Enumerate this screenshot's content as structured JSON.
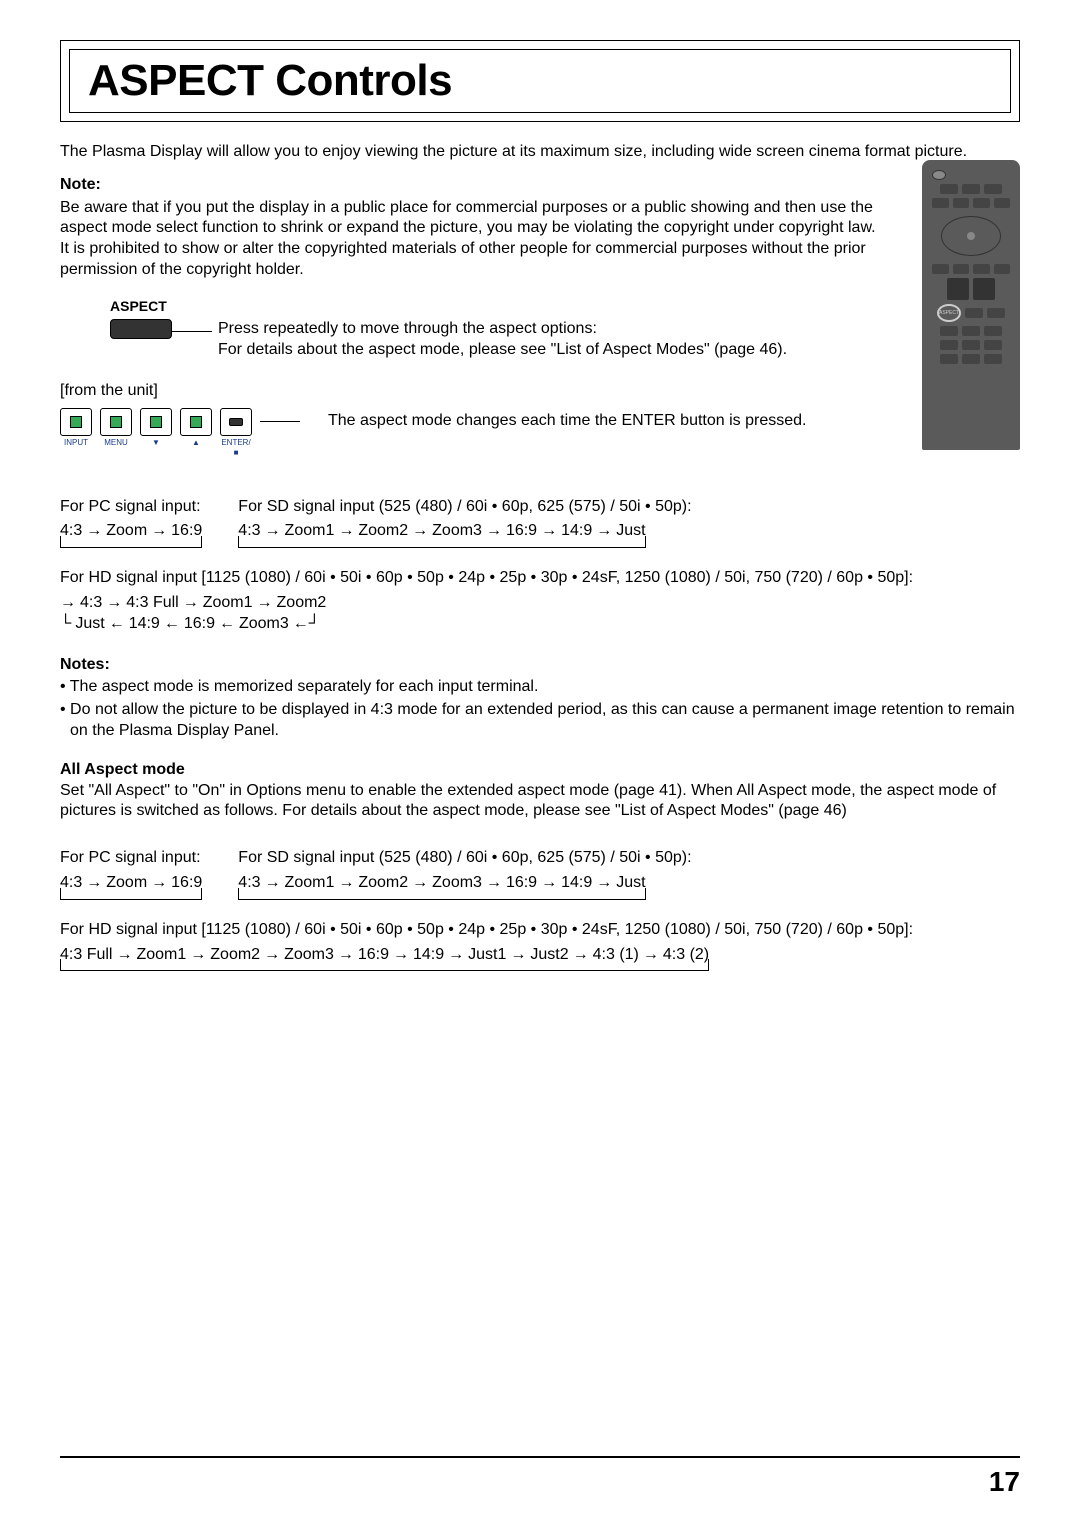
{
  "title": "ASPECT Controls",
  "intro": "The Plasma Display will allow you to enjoy viewing the picture at its maximum size, including wide screen cinema format picture.",
  "note": {
    "heading": "Note:",
    "text": "Be aware that if you put the display in a public place for commercial purposes or a public showing and then use the aspect mode select function to shrink or expand the picture, you may be violating the copyright under copyright law. It is prohibited to show or alter the copyrighted materials of other people for commercial purposes without the prior permission of the copyright holder."
  },
  "aspect": {
    "label": "ASPECT",
    "line1": "Press repeatedly to move through the aspect options:",
    "line2": "For details about the aspect mode, please see \"List of Aspect Modes\" (page 46)."
  },
  "from_unit": {
    "label": "[from the unit]",
    "buttons": [
      "INPUT",
      "MENU",
      "▼",
      "▲",
      "ENTER/■"
    ],
    "text": "The aspect mode changes each time the ENTER button is pressed."
  },
  "pc_signal": {
    "label": "For PC signal input:",
    "cycle": [
      "4:3",
      "Zoom",
      "16:9"
    ]
  },
  "sd_signal": {
    "label": "For SD signal input (525 (480) / 60i • 60p, 625 (575) / 50i • 50p):",
    "cycle": [
      "4:3",
      "Zoom1",
      "Zoom2",
      "Zoom3",
      "16:9",
      "14:9",
      "Just"
    ]
  },
  "hd_signal": {
    "label": "For HD signal input [1125 (1080) / 60i • 50i • 60p • 50p • 24p • 25p • 30p • 24sF, 1250 (1080) / 50i, 750 (720) / 60p • 50p]:",
    "line1": [
      "4:3",
      "4:3 Full",
      "Zoom1",
      "Zoom2"
    ],
    "line2": [
      "Just",
      "14:9",
      "16:9",
      "Zoom3"
    ]
  },
  "notes_section": {
    "heading": "Notes:",
    "items": [
      "The aspect mode is memorized separately for each input terminal.",
      "Do not allow the picture to be displayed in 4:3 mode for an extended period, as this can cause a permanent image retention to remain on the Plasma Display Panel."
    ]
  },
  "all_aspect": {
    "heading": "All Aspect mode",
    "text": "Set \"All Aspect\" to \"On\" in Options menu to enable the extended aspect mode (page 41). When All Aspect mode, the aspect mode of pictures is switched as follows. For details about the aspect mode, please see \"List of Aspect Modes\" (page 46)"
  },
  "aa_pc": {
    "label": "For PC signal input:",
    "cycle": [
      "4:3",
      "Zoom",
      "16:9"
    ]
  },
  "aa_sd": {
    "label": "For SD signal input (525 (480) / 60i • 60p, 625 (575) / 50i • 50p):",
    "cycle": [
      "4:3",
      "Zoom1",
      "Zoom2",
      "Zoom3",
      "16:9",
      "14:9",
      "Just"
    ]
  },
  "aa_hd": {
    "label": "For HD signal input [1125 (1080) / 60i • 50i • 60p • 50p • 24p • 25p • 30p • 24sF, 1250 (1080) / 50i, 750 (720) / 60p • 50p]:",
    "cycle": [
      "4:3 Full",
      "Zoom1",
      "Zoom2",
      "Zoom3",
      "16:9",
      "14:9",
      "Just1",
      "Just2",
      "4:3 (1)",
      "4:3 (2)"
    ]
  },
  "remote": {
    "aspect_label": "ASPECT"
  },
  "page_number": "17"
}
